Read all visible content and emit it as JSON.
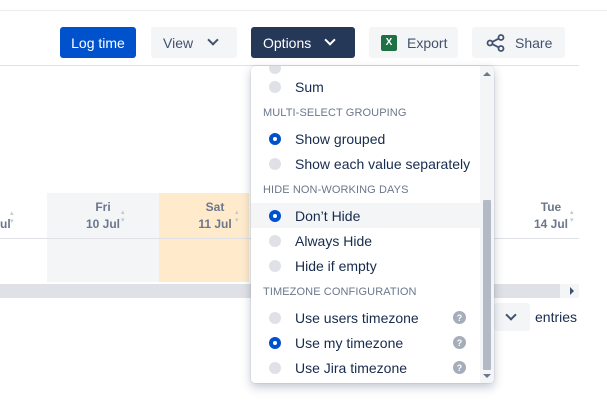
{
  "toolbar": {
    "log_time": "Log time",
    "view": "View",
    "options": "Options",
    "export": "Export",
    "share": "Share"
  },
  "calendar": {
    "days": [
      {
        "name": "",
        "date": "ul"
      },
      {
        "name": "Fri",
        "date": "10 Jul"
      },
      {
        "name": "Sat",
        "date": "11 Jul"
      },
      {
        "name": "Tue",
        "date": "14 Jul"
      }
    ],
    "entries_label": "entries"
  },
  "dropdown": {
    "items_top": [
      {
        "label": "Sum",
        "selected": false
      }
    ],
    "sections": [
      {
        "title": "MULTI-SELECT GROUPING",
        "items": [
          {
            "label": "Show grouped",
            "selected": true
          },
          {
            "label": "Show each value separately",
            "selected": false
          }
        ]
      },
      {
        "title": "HIDE NON-WORKING DAYS",
        "items": [
          {
            "label": "Don’t Hide",
            "selected": true
          },
          {
            "label": "Always Hide",
            "selected": false
          },
          {
            "label": "Hide if empty",
            "selected": false
          }
        ]
      },
      {
        "title": "TIMEZONE CONFIGURATION",
        "items": [
          {
            "label": "Use users timezone",
            "selected": false
          },
          {
            "label": "Use my timezone",
            "selected": true
          },
          {
            "label": "Use Jira timezone",
            "selected": false
          }
        ]
      }
    ]
  },
  "colors": {
    "primary": "#0052cc",
    "options_bg": "#253858",
    "weekend": "#ffebcc"
  }
}
